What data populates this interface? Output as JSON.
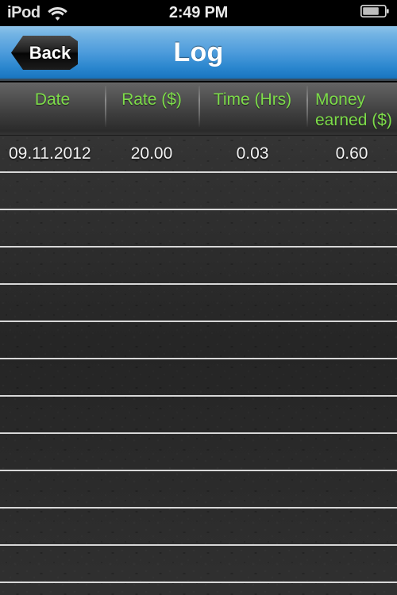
{
  "status_bar": {
    "carrier": "iPod",
    "wifi_icon": "wifi-icon",
    "time": "2:49 PM",
    "battery_icon": "battery-icon",
    "battery_level_pct": 70
  },
  "nav_bar": {
    "back_label": "Back",
    "title": "Log",
    "accent_color": "#4c9bdb"
  },
  "table": {
    "header_text_color": "#7ddc4a",
    "columns": [
      {
        "key": "date",
        "label": "Date"
      },
      {
        "key": "rate",
        "label": "Rate ($)"
      },
      {
        "key": "time",
        "label": "Time (Hrs)"
      },
      {
        "key": "money",
        "label": "Money earned ($)"
      }
    ],
    "rows": [
      {
        "date": "09.11.2012",
        "rate": "20.00",
        "time": "0.03",
        "money": "0.60"
      }
    ],
    "empty_row_count": 11
  }
}
